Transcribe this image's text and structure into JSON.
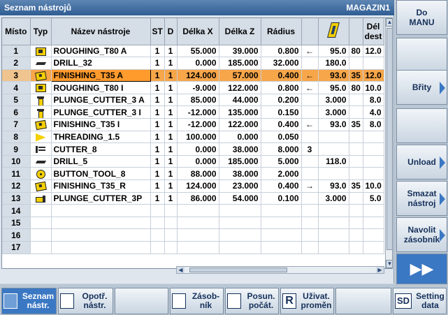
{
  "title_left": "Seznam nástrojů",
  "title_right": "MAGAZIN1",
  "columns": {
    "misto": "Místo",
    "typ": "Typ",
    "nazev": "Název nástroje",
    "st": "ST",
    "d": "D",
    "delka_x": "Délka X",
    "delka_z": "Délka Z",
    "radius": "Rádius",
    "del_dest_1": "Dél",
    "del_dest_2": "dest"
  },
  "rows": [
    {
      "misto": "1",
      "icon": "roughing-tool-icon",
      "name": "ROUGHING_T80 A",
      "st": "1",
      "d": "1",
      "x": "55.000",
      "z": "39.000",
      "r": "0.800",
      "dir": "←",
      "a1": "95.0",
      "a2": "80",
      "del": "12.0"
    },
    {
      "misto": "2",
      "icon": "drill-icon",
      "name": "DRILL_32",
      "st": "1",
      "d": "1",
      "x": "0.000",
      "z": "185.000",
      "r": "32.000",
      "dir": "",
      "a1": "180.0",
      "a2": "",
      "del": ""
    },
    {
      "misto": "3",
      "icon": "finishing-tool-icon",
      "name": "FINISHING_T35 A",
      "st": "1",
      "d": "1",
      "x": "124.000",
      "z": "57.000",
      "r": "0.400",
      "dir": "←",
      "a1": "93.0",
      "a2": "35",
      "del": "12.0"
    },
    {
      "misto": "4",
      "icon": "roughing-tool-icon",
      "name": "ROUGHING_T80 I",
      "st": "1",
      "d": "1",
      "x": "-9.000",
      "z": "122.000",
      "r": "0.800",
      "dir": "←",
      "a1": "95.0",
      "a2": "80",
      "del": "10.0"
    },
    {
      "misto": "5",
      "icon": "plunge-cutter-icon",
      "name": "PLUNGE_CUTTER_3 A",
      "st": "1",
      "d": "1",
      "x": "85.000",
      "z": "44.000",
      "r": "0.200",
      "dir": "",
      "a1": "3.000",
      "a2": "",
      "del": "8.0"
    },
    {
      "misto": "6",
      "icon": "plunge-cutter-icon",
      "name": "PLUNGE_CUTTER_3 I",
      "st": "1",
      "d": "1",
      "x": "-12.000",
      "z": "135.000",
      "r": "0.150",
      "dir": "",
      "a1": "3.000",
      "a2": "",
      "del": "4.0"
    },
    {
      "misto": "7",
      "icon": "finishing-tool-icon",
      "name": "FINISHING_T35 I",
      "st": "1",
      "d": "1",
      "x": "-12.000",
      "z": "122.000",
      "r": "0.400",
      "dir": "←",
      "a1": "93.0",
      "a2": "35",
      "del": "8.0"
    },
    {
      "misto": "8",
      "icon": "threading-tool-icon",
      "name": "THREADING_1.5",
      "st": "1",
      "d": "1",
      "x": "100.000",
      "z": "0.000",
      "r": "0.050",
      "dir": "",
      "a1": "",
      "a2": "",
      "del": ""
    },
    {
      "misto": "9",
      "icon": "cutter-icon",
      "name": "CUTTER_8",
      "st": "1",
      "d": "1",
      "x": "0.000",
      "z": "38.000",
      "r": "8.000",
      "dir": "3",
      "a1": "",
      "a2": "",
      "del": ""
    },
    {
      "misto": "10",
      "icon": "drill-icon",
      "name": "DRILL_5",
      "st": "1",
      "d": "1",
      "x": "0.000",
      "z": "185.000",
      "r": "5.000",
      "dir": "",
      "a1": "118.0",
      "a2": "",
      "del": ""
    },
    {
      "misto": "11",
      "icon": "button-tool-icon",
      "name": "BUTTON_TOOL_8",
      "st": "1",
      "d": "1",
      "x": "88.000",
      "z": "38.000",
      "r": "2.000",
      "dir": "",
      "a1": "",
      "a2": "",
      "del": ""
    },
    {
      "misto": "12",
      "icon": "finishing-tool-icon",
      "name": "FINISHING_T35_R",
      "st": "1",
      "d": "1",
      "x": "124.000",
      "z": "23.000",
      "r": "0.400",
      "dir": "→",
      "a1": "93.0",
      "a2": "35",
      "del": "10.0"
    },
    {
      "misto": "13",
      "icon": "plunge-cutter-3p-icon",
      "name": "PLUNGE_CUTTER_3P",
      "st": "1",
      "d": "1",
      "x": "86.000",
      "z": "54.000",
      "r": "0.100",
      "dir": "",
      "a1": "3.000",
      "a2": "",
      "del": "5.0"
    },
    {
      "misto": "14",
      "icon": "",
      "name": "",
      "st": "",
      "d": "",
      "x": "",
      "z": "",
      "r": "",
      "dir": "",
      "a1": "",
      "a2": "",
      "del": ""
    },
    {
      "misto": "15",
      "icon": "",
      "name": "",
      "st": "",
      "d": "",
      "x": "",
      "z": "",
      "r": "",
      "dir": "",
      "a1": "",
      "a2": "",
      "del": ""
    },
    {
      "misto": "16",
      "icon": "",
      "name": "",
      "st": "",
      "d": "",
      "x": "",
      "z": "",
      "r": "",
      "dir": "",
      "a1": "",
      "a2": "",
      "del": ""
    },
    {
      "misto": "17",
      "icon": "",
      "name": "",
      "st": "",
      "d": "",
      "x": "",
      "z": "",
      "r": "",
      "dir": "",
      "a1": "",
      "a2": "",
      "del": ""
    }
  ],
  "selected_row": 3,
  "vertical_softkeys": [
    {
      "label": "Do\nMANU",
      "arrow": false
    },
    {
      "label": "",
      "arrow": false
    },
    {
      "label": "Břity",
      "arrow": true
    },
    {
      "label": "",
      "arrow": false
    },
    {
      "label": "Unload",
      "arrow": true
    },
    {
      "label": "Smazat\nnástroj",
      "arrow": true
    },
    {
      "label": "Navolit\nzásobník",
      "arrow": true
    },
    {
      "label": "▶▶",
      "arrow": false,
      "blue": true
    }
  ],
  "horizontal_softkeys": [
    {
      "label": "Seznam\nnástr.",
      "active": true,
      "icon": "tool-list-icon"
    },
    {
      "label": "Opotř.\nnástr.",
      "active": false,
      "icon": "tool-wear-icon"
    },
    {
      "label": "",
      "active": false,
      "icon": ""
    },
    {
      "label": "Zásob-\nník",
      "active": false,
      "icon": "magazine-icon"
    },
    {
      "label": "Posun.\npočát.",
      "active": false,
      "icon": "work-offset-icon"
    },
    {
      "label": "Uživat.\nproměn",
      "active": false,
      "icon": "R"
    },
    {
      "label": "",
      "active": false,
      "icon": ""
    },
    {
      "label": "Setting\ndata",
      "active": false,
      "icon": "SD"
    }
  ],
  "colors": {
    "title_bg": "#2f5d93",
    "selected_row": "#f7a64a",
    "softkey_active": "#3b78c3",
    "tool_yellow": "#f5d000"
  }
}
